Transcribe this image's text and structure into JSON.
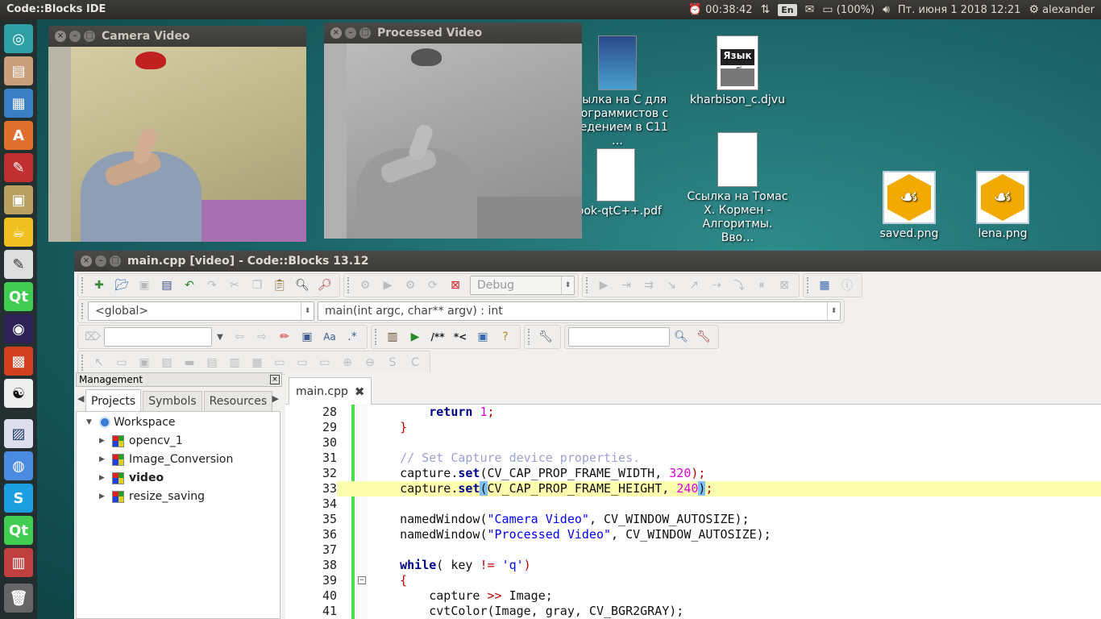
{
  "top_panel": {
    "app_title": "Code::Blocks IDE",
    "timer": "00:38:42",
    "language": "En",
    "battery": "(100%)",
    "datetime": "Пт. июня  1 2018 12:21",
    "user": "alexander"
  },
  "camera_window": {
    "title": "Camera Video"
  },
  "processed_window": {
    "title": "Processed Video"
  },
  "desktop_icons": [
    {
      "label": "Ссылка на С для программистов с введением в С11 …"
    },
    {
      "label": "kharbison_c.djvu"
    },
    {
      "label": "book-qtC++.pdf"
    },
    {
      "label": "Ссылка на Томас Х. Кормен - Алгоритмы. Вво…"
    },
    {
      "label": "saved.png"
    },
    {
      "label": "lena.png"
    }
  ],
  "ide": {
    "title": "main.cpp [video] - Code::Blocks 13.12",
    "build_target": "Debug",
    "scope_combo": "<global>",
    "function_combo": "main(int argc, char** argv) : int",
    "search_value": "",
    "search2_value": ""
  },
  "management": {
    "header": "Management",
    "tabs": [
      "Projects",
      "Symbols",
      "Resources"
    ],
    "workspace_label": "Workspace",
    "projects": [
      "opencv_1",
      "Image_Conversion",
      "video",
      "resize_saving"
    ]
  },
  "editor": {
    "tab_label": "main.cpp",
    "lines": [
      {
        "n": "28"
      },
      {
        "n": "29"
      },
      {
        "n": "30"
      },
      {
        "n": "31"
      },
      {
        "n": "32"
      },
      {
        "n": "33"
      },
      {
        "n": "34"
      },
      {
        "n": "35"
      },
      {
        "n": "36"
      },
      {
        "n": "37"
      },
      {
        "n": "38"
      },
      {
        "n": "39"
      },
      {
        "n": "40"
      },
      {
        "n": "41"
      }
    ],
    "code": {
      "l28": [
        "return",
        "1",
        ";"
      ],
      "l29": "}",
      "l31": "// Set Capture device properties.",
      "l32": [
        "capture.",
        "set",
        "(CV_CAP_PROP_FRAME_WIDTH, ",
        "320",
        ");"
      ],
      "l33": [
        "capture.",
        "set",
        "(",
        "CV_CAP_PROP_FRAME_HEIGHT, ",
        "240",
        ")",
        ";"
      ],
      "l35": [
        "namedWindow(",
        "\"Camera Video\"",
        ", CV_WINDOW_AUTOSIZE);"
      ],
      "l36": [
        "namedWindow(",
        "\"Processed Video\"",
        ", CV_WINDOW_AUTOSIZE);"
      ],
      "l38": [
        "while",
        "( key ",
        "!=",
        " ",
        "'q'",
        ")"
      ],
      "l39": "{",
      "l40": [
        "capture ",
        ">>",
        " Image;"
      ],
      "l41": [
        "cvtColor(Image, gray, CV_BGR2GRAY);"
      ]
    }
  }
}
